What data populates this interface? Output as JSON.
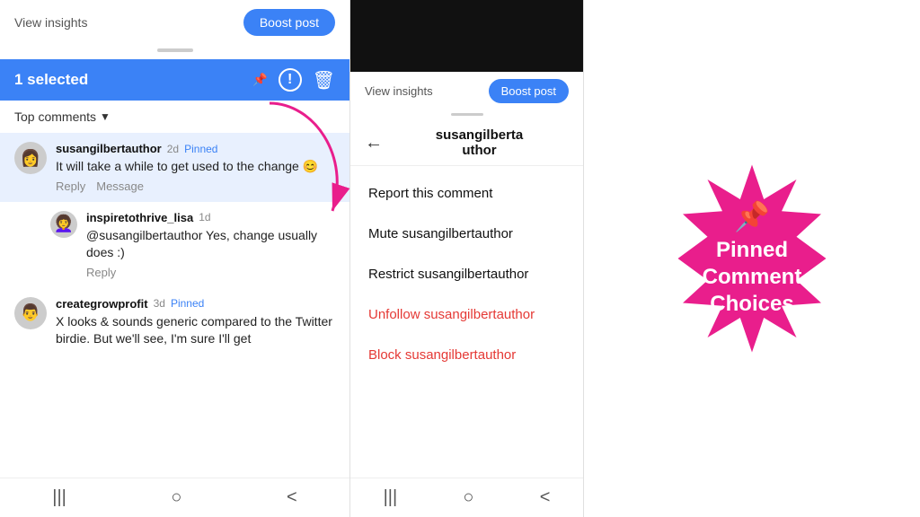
{
  "leftPanel": {
    "topBar": {
      "viewInsights": "View insights",
      "boostPost": "Boost post"
    },
    "selectedBar": {
      "text": "1 selected",
      "icons": {
        "pin": "📌",
        "exclaim": "!",
        "trash": "🗑"
      }
    },
    "filter": {
      "label": "Top comments",
      "arrow": "▼"
    },
    "comments": [
      {
        "id": "c1",
        "username": "susangilbertauthor",
        "time": "2d",
        "pinned": true,
        "pinnedLabel": "Pinned",
        "text": "It will take a while to get used to the change 😊",
        "actions": [
          "Reply",
          "Message"
        ],
        "highlighted": true,
        "avatarEmoji": "👩"
      },
      {
        "id": "c2",
        "username": "inspiretothrive_lisa",
        "time": "1d",
        "pinned": false,
        "pinnedLabel": "",
        "text": "@susangilbertauthor Yes, change usually does :)",
        "actions": [
          "Reply"
        ],
        "highlighted": false,
        "avatarEmoji": "👩‍🦱"
      },
      {
        "id": "c3",
        "username": "creategrowprofit",
        "time": "3d",
        "pinned": true,
        "pinnedLabel": "Pinned",
        "text": "X looks & sounds generic compared to the Twitter birdie. But we'll see, I'm sure I'll get",
        "actions": [],
        "highlighted": false,
        "avatarEmoji": "👨"
      }
    ],
    "nav": [
      "|||",
      "○",
      "<"
    ]
  },
  "rightPanel": {
    "topBar": {
      "viewInsights": "View insights",
      "boostPost": "Boost post"
    },
    "backArrow": "←",
    "profileName": "susangilberta\nuthor",
    "menuOptions": [
      {
        "id": "report",
        "label": "Report this comment",
        "red": false
      },
      {
        "id": "mute",
        "label": "Mute susangilbertauthor",
        "red": false
      },
      {
        "id": "restrict",
        "label": "Restrict susangilbertauthor",
        "red": false
      },
      {
        "id": "unfollow",
        "label": "Unfollow susangilbertauthor",
        "red": true
      },
      {
        "id": "block",
        "label": "Block susangilbertauthor",
        "red": true
      }
    ],
    "nav": [
      "|||",
      "○",
      "<"
    ]
  },
  "annotation": {
    "title": "Pinned\nComment\nChoices",
    "pinEmoji": "📌",
    "starburstColor": "#e91e8c"
  }
}
